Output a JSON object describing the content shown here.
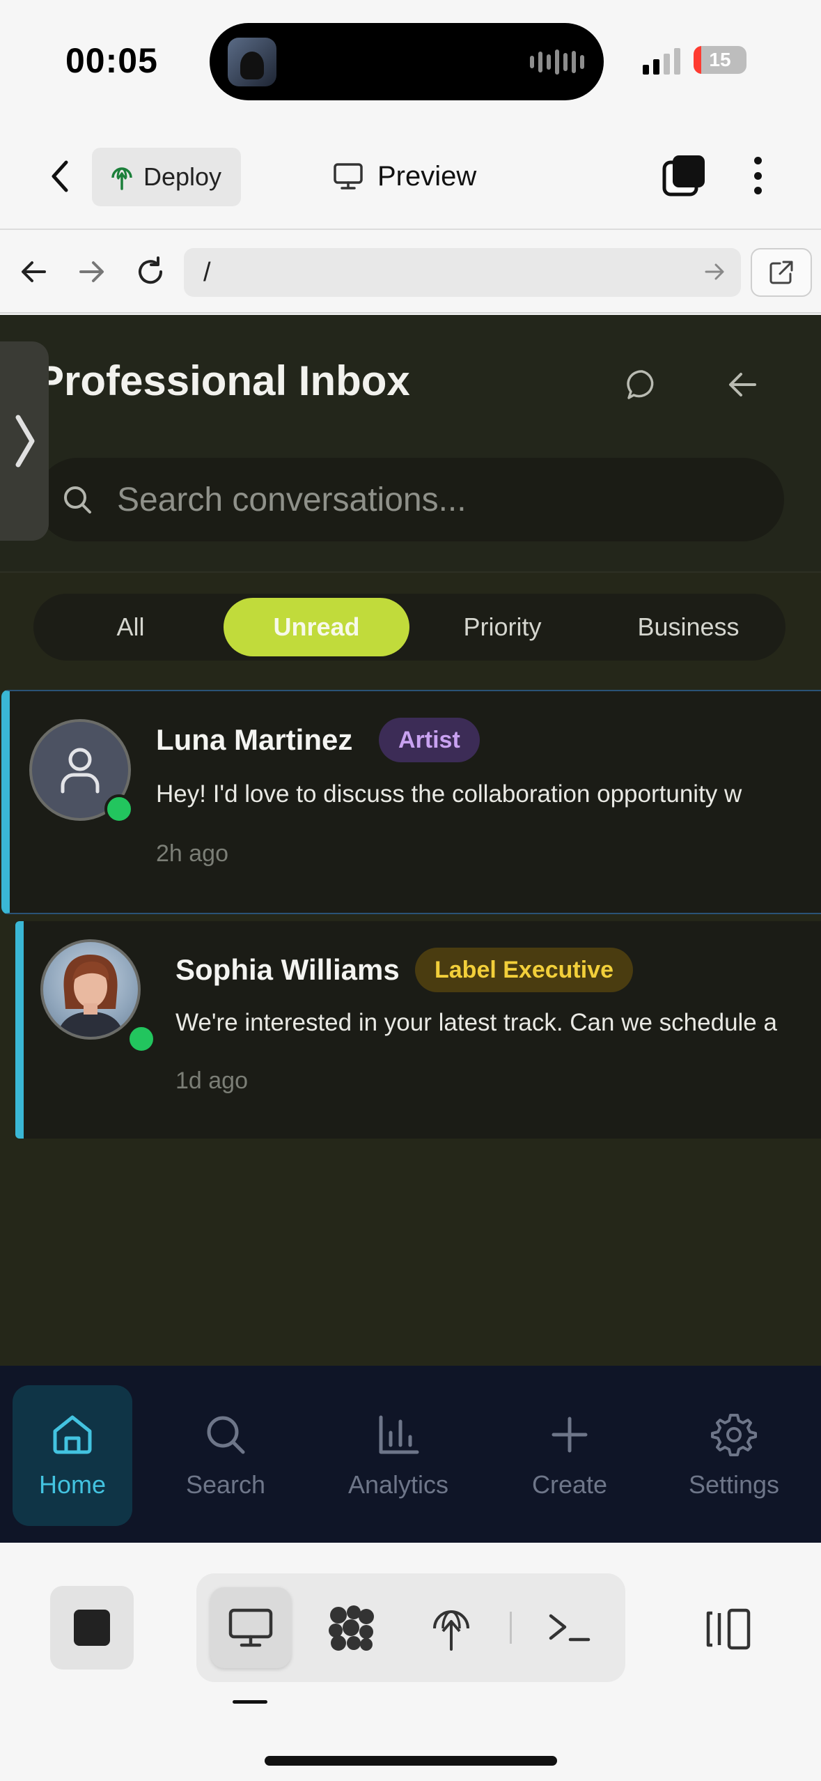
{
  "status_bar": {
    "time": "00:05",
    "battery": "15",
    "battery_level": 0.15
  },
  "toolbar": {
    "deploy_label": "Deploy",
    "preview_label": "Preview"
  },
  "urlbar": {
    "url": "/"
  },
  "app": {
    "title": "Professional Inbox",
    "search_placeholder": "Search conversations...",
    "tabs": [
      {
        "label": "All",
        "active": false
      },
      {
        "label": "Unread",
        "active": true
      },
      {
        "label": "Priority",
        "active": false
      },
      {
        "label": "Business",
        "active": false
      }
    ],
    "conversations": [
      {
        "name": "Luna Martinez",
        "role": "Artist",
        "message": "Hey! I'd love to discuss the collaboration opportunity w",
        "time": "2h ago",
        "online": true
      },
      {
        "name": "Sophia Williams",
        "role": "Label Executive",
        "message": "We're interested in your latest track. Can we schedule a",
        "time": "1d ago",
        "online": true
      }
    ],
    "bottom_nav": [
      {
        "label": "Home",
        "icon": "home-icon",
        "active": true
      },
      {
        "label": "Search",
        "icon": "search-icon",
        "active": false
      },
      {
        "label": "Analytics",
        "icon": "analytics-icon",
        "active": false
      },
      {
        "label": "Create",
        "icon": "plus-icon",
        "active": false
      },
      {
        "label": "Settings",
        "icon": "gear-icon",
        "active": false
      }
    ]
  },
  "colors": {
    "accent_lime": "#c1db3b",
    "accent_cyan": "#3ab7d5",
    "online_green": "#22c55e",
    "app_background": "#252719",
    "nav_background": "#0f1527"
  }
}
